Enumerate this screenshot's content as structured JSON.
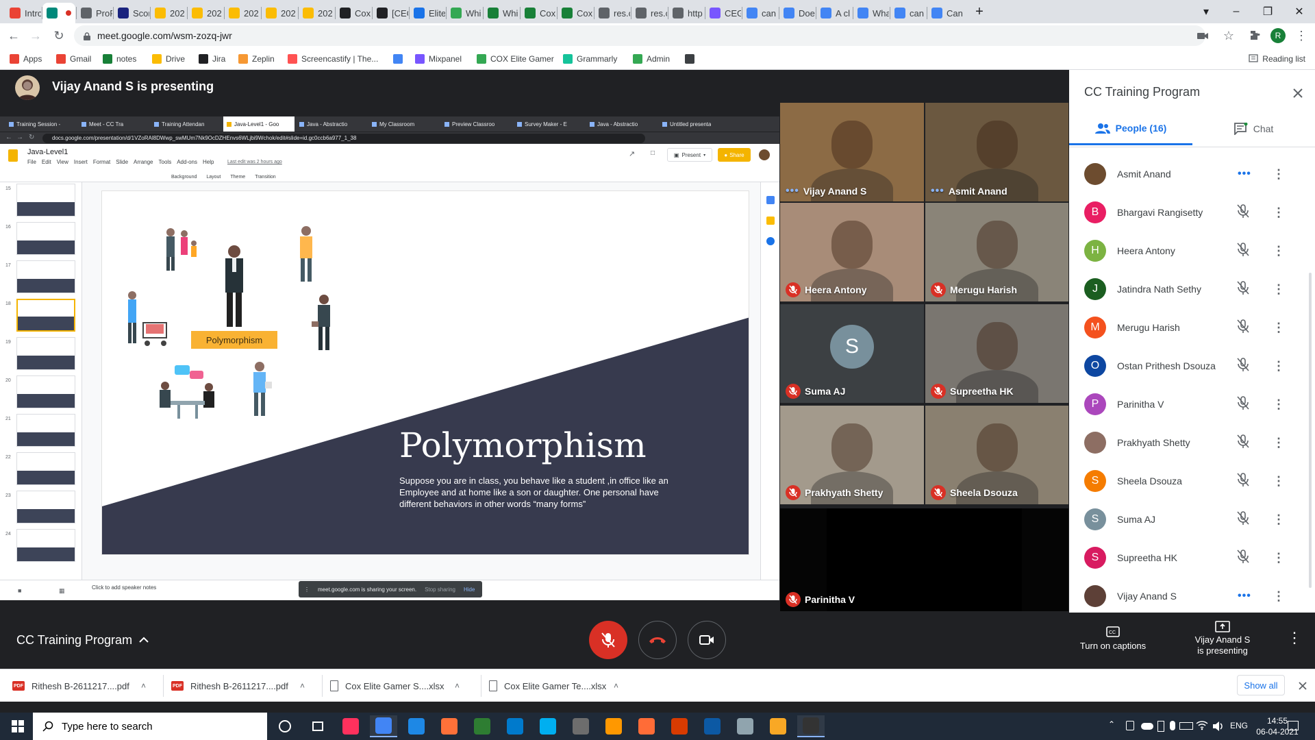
{
  "browser": {
    "tabs": [
      {
        "label": "Intro",
        "icon": "gmail-icon",
        "color": "#ea4335"
      },
      {
        "label": "",
        "icon": "meet-icon",
        "color": "#00897b",
        "active": true
      },
      {
        "label": "ProF",
        "icon": "globe-icon",
        "color": "#5f6368"
      },
      {
        "label": "Scor",
        "icon": "pdf-icon",
        "color": "#1a237e"
      },
      {
        "label": "202",
        "icon": "pinwheel-icon",
        "color": "#fbbc04"
      },
      {
        "label": "202",
        "icon": "pinwheel-icon",
        "color": "#fbbc04"
      },
      {
        "label": "202",
        "icon": "pinwheel-icon",
        "color": "#fbbc04"
      },
      {
        "label": "202",
        "icon": "pinwheel-icon",
        "color": "#fbbc04"
      },
      {
        "label": "202",
        "icon": "pinwheel-icon",
        "color": "#fbbc04"
      },
      {
        "label": "Cox",
        "icon": "check-icon",
        "color": "#202124"
      },
      {
        "label": "[CEC",
        "icon": "check-icon",
        "color": "#202124"
      },
      {
        "label": "Elite",
        "icon": "gear-icon",
        "color": "#1a73e8"
      },
      {
        "label": "Whi",
        "icon": "drive-icon",
        "color": "#34a853"
      },
      {
        "label": "Whi",
        "icon": "sheets-icon",
        "color": "#188038"
      },
      {
        "label": "Cox",
        "icon": "sheets-icon",
        "color": "#188038"
      },
      {
        "label": "Cox",
        "icon": "sheets-icon",
        "color": "#188038"
      },
      {
        "label": "res.c",
        "icon": "globe-icon",
        "color": "#5f6368"
      },
      {
        "label": "res.c",
        "icon": "globe-icon",
        "color": "#5f6368"
      },
      {
        "label": "http",
        "icon": "globe-icon",
        "color": "#5f6368"
      },
      {
        "label": "CEG",
        "icon": "mixpanel-icon",
        "color": "#7856ff"
      },
      {
        "label": "can",
        "icon": "google-icon",
        "color": "#4285f4"
      },
      {
        "label": "Doe",
        "icon": "google-icon",
        "color": "#4285f4"
      },
      {
        "label": "A cl",
        "icon": "google-icon",
        "color": "#4285f4"
      },
      {
        "label": "Wha",
        "icon": "google-icon",
        "color": "#4285f4"
      },
      {
        "label": "can",
        "icon": "google-icon",
        "color": "#4285f4"
      },
      {
        "label": "Can",
        "icon": "google-icon",
        "color": "#4285f4"
      }
    ],
    "url": "meet.google.com/wsm-zozq-jwr",
    "profile_initial": "R",
    "bookmarks": [
      {
        "label": "Apps",
        "icon": "apps-grid-icon",
        "color": "#ea4335"
      },
      {
        "label": "Gmail",
        "icon": "gmail-icon",
        "color": "#ea4335"
      },
      {
        "label": "notes",
        "icon": "sheets-icon",
        "color": "#188038"
      },
      {
        "label": "Drive",
        "icon": "drive-icon",
        "color": "#fbbc04"
      },
      {
        "label": "Jira",
        "icon": "check-icon",
        "color": "#202124"
      },
      {
        "label": "Zeplin",
        "icon": "zeplin-icon",
        "color": "#f69833"
      },
      {
        "label": "Screencastify | The...",
        "icon": "screencastify-icon",
        "color": "#ff5252"
      },
      {
        "label": "",
        "icon": "google-translate-icon",
        "color": "#4285f4"
      },
      {
        "label": "Mixpanel",
        "icon": "mixpanel-icon",
        "color": "#7856ff"
      },
      {
        "label": "COX Elite Gamer",
        "icon": "sheets-icon",
        "color": "#34a853"
      },
      {
        "label": "Grammarly",
        "icon": "grammarly-icon",
        "color": "#15c39a"
      },
      {
        "label": "Admin",
        "icon": "sheets-icon",
        "color": "#34a853"
      },
      {
        "label": "",
        "icon": "bulb-icon",
        "color": "#3c4043"
      }
    ],
    "reading_list": "Reading list"
  },
  "meet": {
    "presenter_title": "Vijay Anand S is presenting",
    "panel": {
      "title": "CC Training Program",
      "people_tab": "People (16)",
      "chat_tab": "Chat",
      "people": [
        {
          "name": "Asmit Anand",
          "initial": "",
          "color": "#6d4c2f",
          "status": "talking"
        },
        {
          "name": "Bhargavi Rangisetty",
          "initial": "B",
          "color": "#e91e63",
          "status": "muted"
        },
        {
          "name": "Heera Antony",
          "initial": "H",
          "color": "#7cb342",
          "status": "muted"
        },
        {
          "name": "Jatindra Nath Sethy",
          "initial": "J",
          "color": "#1b5e20",
          "status": "muted"
        },
        {
          "name": "Merugu Harish",
          "initial": "M",
          "color": "#f4511e",
          "status": "muted"
        },
        {
          "name": "Ostan Prithesh Dsouza",
          "initial": "O",
          "color": "#0d47a1",
          "status": "muted"
        },
        {
          "name": "Parinitha V",
          "initial": "P",
          "color": "#ab47bc",
          "status": "muted"
        },
        {
          "name": "Prakhyath Shetty",
          "initial": "",
          "color": "#8d6e63",
          "status": "muted"
        },
        {
          "name": "Sheela Dsouza",
          "initial": "S",
          "color": "#f57c00",
          "status": "muted"
        },
        {
          "name": "Suma AJ",
          "initial": "S",
          "color": "#78909c",
          "status": "muted"
        },
        {
          "name": "Supreetha HK",
          "initial": "S",
          "color": "#d81b60",
          "status": "muted"
        },
        {
          "name": "Vijay Anand S",
          "initial": "",
          "color": "#5d4037",
          "status": "talking"
        }
      ]
    },
    "tiles": [
      {
        "name": "Vijay Anand S",
        "status": "talking",
        "bg": "#8c6b45"
      },
      {
        "name": "Asmit Anand",
        "status": "talking",
        "bg": "#6b5840"
      },
      {
        "name": "Heera Antony",
        "status": "muted",
        "bg": "#a88c78"
      },
      {
        "name": "Merugu Harish",
        "status": "muted",
        "bg": "#8a8478"
      },
      {
        "name": "Suma AJ",
        "status": "muted",
        "bg": "#3c4043",
        "initial": "S"
      },
      {
        "name": "Supreetha HK",
        "status": "muted",
        "bg": "#7a7670"
      },
      {
        "name": "Prakhyath Shetty",
        "status": "muted",
        "bg": "#a39a8c"
      },
      {
        "name": "Sheela Dsouza",
        "status": "muted",
        "bg": "#8a8070"
      },
      {
        "name": "Parinitha V",
        "status": "muted",
        "bg": "#050505"
      }
    ],
    "meeting_name": "CC Training Program",
    "captions_label": "Turn on captions",
    "presenting_label_1": "Vijay Anand S",
    "presenting_label_2": "is presenting"
  },
  "shared_screen": {
    "tabs": [
      "Training Session -",
      "Meet - CC Tra",
      "Training Attendan",
      "Java-Level1 - Goo",
      "Java - Abstractio",
      "My Classroom",
      "Preview Classroo",
      "Survey Maker - E",
      "Java - Abstractio",
      "Untitled presenta"
    ],
    "url": "docs.google.com/presentation/d/1VZoRAl8DWwp_swMUm7Nk9OcDZHEnvs6WLjbi9Wchok/edit#slide=id.gc0ccb6a977_1_38",
    "doc_title": "Java-Level1",
    "menu": [
      "File",
      "Edit",
      "View",
      "Insert",
      "Format",
      "Slide",
      "Arrange",
      "Tools",
      "Add-ons",
      "Help"
    ],
    "last_edit": "Last edit was 2 hours ago",
    "present_label": "Present",
    "share_label": "Share",
    "toolbar_items": [
      "Background",
      "Layout",
      "Theme",
      "Transition"
    ],
    "slide_numbers": [
      "15",
      "16",
      "17",
      "18",
      "19",
      "20",
      "21",
      "22",
      "23",
      "24"
    ],
    "slide": {
      "label_box": "Polymorphism",
      "title": "Polymorphism",
      "body": "Suppose you are in class, you behave like a student ,in office like an Employee and at home like a son or daughter. One personal have different behaviors in other words “many forms”"
    },
    "speaker_notes": "Click to add speaker notes",
    "sharing_banner": "meet.google.com is sharing your screen.",
    "stop_sharing": "Stop sharing",
    "hide": "Hide"
  },
  "downloads": [
    {
      "name": "Rithesh B-2611217....pdf",
      "type": "pdf"
    },
    {
      "name": "Rithesh B-2611217....pdf",
      "type": "pdf"
    },
    {
      "name": "Cox Elite Gamer S....xlsx",
      "type": "file"
    },
    {
      "name": "Cox Elite Gamer Te....xlsx",
      "type": "file"
    }
  ],
  "show_all": "Show all",
  "taskbar": {
    "search_placeholder": "Type here to search",
    "language": "ENG",
    "time": "14:55",
    "date": "06-04-2021",
    "apps": [
      {
        "icon": "task-view-icon",
        "color": "transparent"
      },
      {
        "icon": "multitask-icon",
        "color": "transparent"
      },
      {
        "icon": "intellij-icon",
        "color": "#fe315d"
      },
      {
        "icon": "chrome-icon",
        "color": "#4285f4"
      },
      {
        "icon": "vmware-icon",
        "color": "#1e88e5"
      },
      {
        "icon": "firefox-icon",
        "color": "#ff7139"
      },
      {
        "icon": "greenshot-icon",
        "color": "#2e7d32"
      },
      {
        "icon": "vscode-icon",
        "color": "#007acc"
      },
      {
        "icon": "skype-icon",
        "color": "#00aff0"
      },
      {
        "icon": "word-icon",
        "color": "#6d6d6d"
      },
      {
        "icon": "sublime-icon",
        "color": "#ff9800"
      },
      {
        "icon": "postman-icon",
        "color": "#ff6c37"
      },
      {
        "icon": "office-icon",
        "color": "#d83b01"
      },
      {
        "icon": "edge-icon",
        "color": "#0c59a4"
      },
      {
        "icon": "settings-app-icon",
        "color": "#90a4ae"
      },
      {
        "icon": "folder-icon",
        "color": "#f9a825"
      },
      {
        "icon": "audio-app-icon",
        "color": "#333"
      }
    ]
  }
}
